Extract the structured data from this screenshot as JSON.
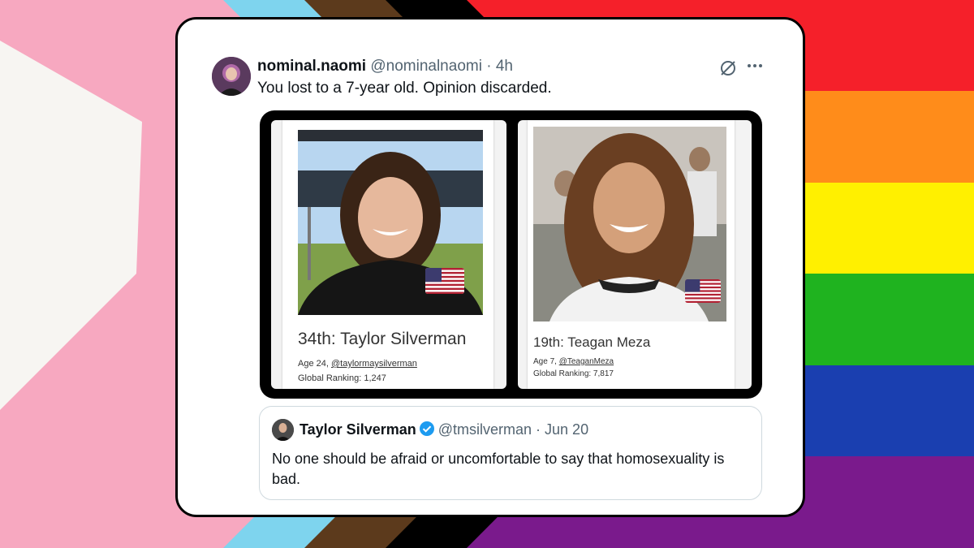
{
  "tweet": {
    "display_name": "nominal.naomi",
    "handle": "@nominalnaomi",
    "separator": " · ",
    "time": "4h",
    "text": "You lost to a 7-year old. Opinion discarded."
  },
  "icons": {
    "grok": "grok-icon",
    "more": "more-icon",
    "verified": "verified-badge-icon",
    "flag": "us-flag-icon"
  },
  "media": {
    "left": {
      "rank": "34th: Taylor Silverman",
      "age_prefix": "Age 24, ",
      "handle": "@taylormaysilverman",
      "global_ranking": "Global Ranking: 1,247"
    },
    "right": {
      "rank": "19th: Teagan Meza",
      "age_prefix": "Age 7, ",
      "handle": "@TeaganMeza",
      "global_ranking": "Global Ranking: 7,817"
    }
  },
  "quote": {
    "display_name": "Taylor Silverman",
    "handle": "@tmsilverman",
    "separator": " · ",
    "date": "Jun 20",
    "text": "No one should be afraid or uncomfortable to say that homosexuality is bad."
  },
  "colors": {
    "rainbow": [
      "#f5202a",
      "#ff8c1a",
      "#fff000",
      "#1fb31f",
      "#1a3fb0",
      "#7a1a8c"
    ],
    "progress_chevrons": [
      "#000000",
      "#5c3a1c",
      "#7ed4ee",
      "#f7a8c0",
      "#f7f5f2"
    ],
    "verified": "#1d9bf0"
  }
}
